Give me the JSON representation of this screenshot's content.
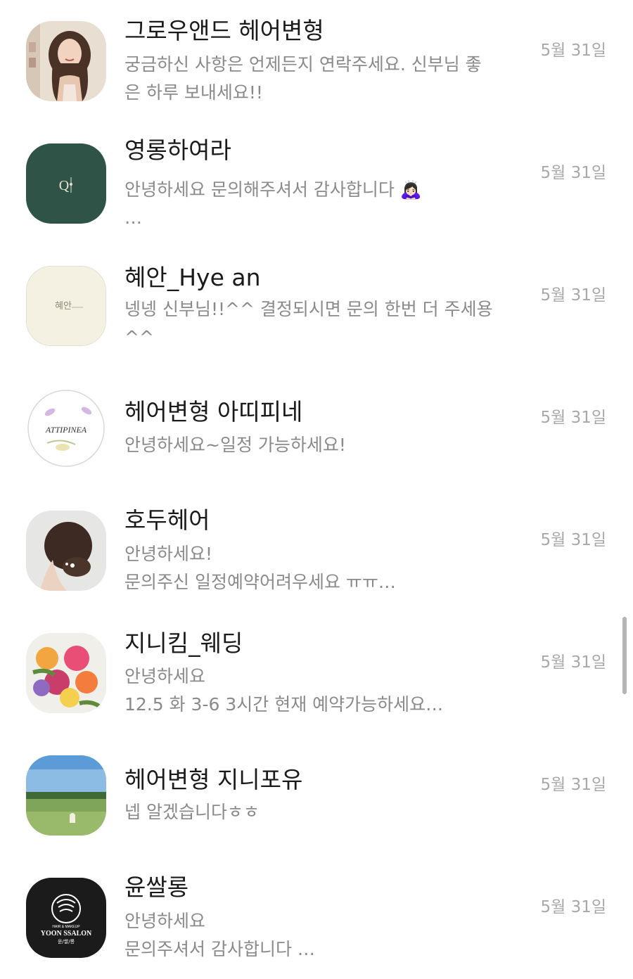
{
  "chats": [
    {
      "name": "그로우앤드 헤어변형",
      "preview": "궁금하신 사항은 언제든지 연락주세요. 신부님 좋\n은 하루 보내세요!!",
      "date": "5월 31일",
      "avatar_icon": "woman-portrait-icon"
    },
    {
      "name": "영롱하여라",
      "preview": "안녕하세요 문의해주셔서 감사합니다 🙇🏻‍♀️\n…",
      "date": "5월 31일",
      "avatar_icon": "green-logo-icon",
      "avatar_logo_text": "Q"
    },
    {
      "name": "혜안_Hye an",
      "preview": "넹넹 신부님!!^^ 결정되시면 문의 한번 더 주세용\n^^",
      "date": "5월 31일",
      "avatar_icon": "cream-logo-icon",
      "avatar_logo_text": "혜안"
    },
    {
      "name": "헤어변형 아띠피네",
      "preview": "안녕하세요~일정 가능하세요!",
      "date": "5월 31일",
      "avatar_icon": "floral-logo-icon",
      "avatar_logo_text": "ATTIPINEA"
    },
    {
      "name": "호두헤어",
      "preview": "안녕하세요!\n문의주신 일정예약어려우세요 ㅠㅠ…",
      "date": "5월 31일",
      "avatar_icon": "hair-updo-icon"
    },
    {
      "name": "지니킴_웨딩",
      "preview": "안녕하세요\n12.5 화 3-6 3시간 현재 예약가능하세요…",
      "date": "5월 31일",
      "avatar_icon": "flower-bouquet-icon"
    },
    {
      "name": "헤어변형 지니포유",
      "preview": "넵 알겠습니다ㅎㅎ",
      "date": "5월 31일",
      "avatar_icon": "meadow-photo-icon"
    },
    {
      "name": "윤쌀롱",
      "preview": "안녕하세요\n문의주셔서 감사합니다 …",
      "date": "5월 31일",
      "avatar_icon": "salon-logo-icon",
      "avatar_logo_text": "YOON SSALON",
      "avatar_logo_top": "HAIR & MAKEUP",
      "avatar_logo_sub": "윤/쌀/롱"
    }
  ],
  "colors": {
    "name": "#1a1a1a",
    "preview": "#8a8a8a",
    "date": "#a8a8a8",
    "scrollbar": "#b5b5b5"
  }
}
